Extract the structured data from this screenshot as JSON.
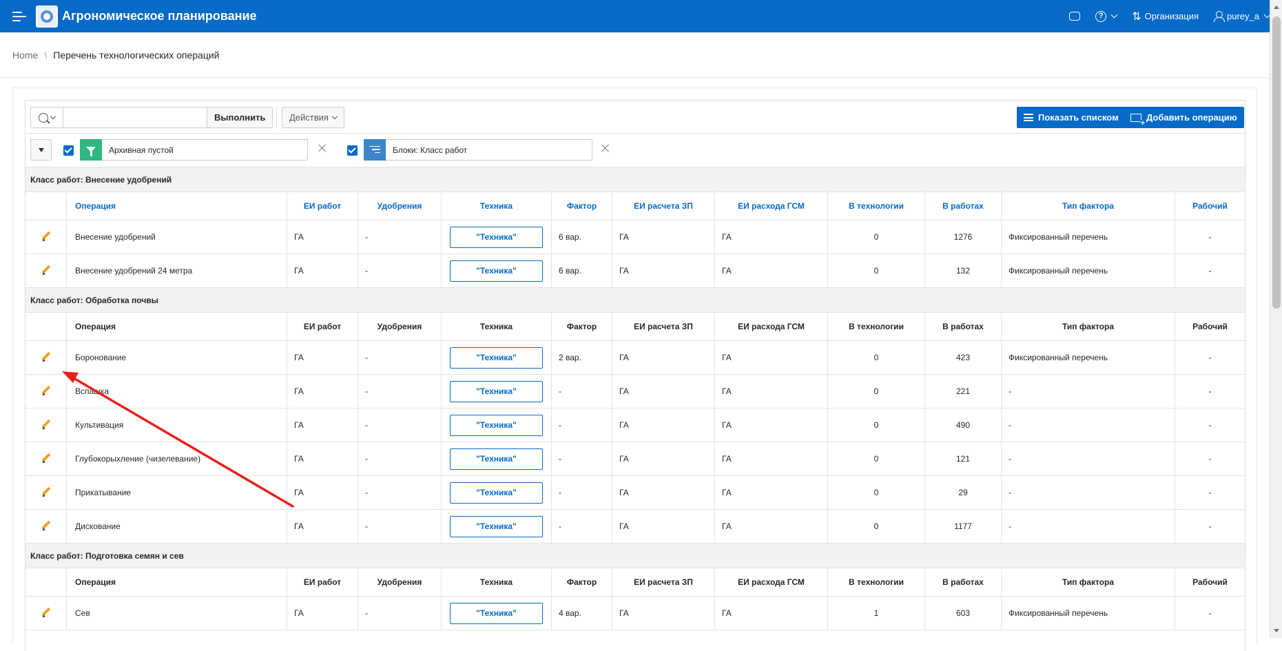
{
  "header": {
    "app_title": "Агрономическое планирование",
    "org_label": "Организация",
    "user_label": "purey_a"
  },
  "breadcrumb": {
    "home": "Home",
    "current": "Перечень технологических операций"
  },
  "toolbar": {
    "search_value": "",
    "exec_label": "Выполнить",
    "actions_label": "Действия",
    "show_list_label": "Показать списком",
    "add_operation_label": "Добавить операцию"
  },
  "filters": [
    {
      "label": "Архивная пустой",
      "type": "filter",
      "color": "#2eb87f"
    },
    {
      "label": "Блоки: Класс работ",
      "type": "control-break",
      "color": "#3a86c8"
    }
  ],
  "columns": [
    "Операция",
    "ЕИ работ",
    "Удобрения",
    "Техника",
    "Фактор",
    "ЕИ расчета ЗП",
    "ЕИ расхода ГСМ",
    "В технологии",
    "В работах",
    "Тип фактора",
    "Рабочий"
  ],
  "tech_button_label": "\"Техника\"",
  "groups": [
    {
      "title": "Класс работ: Внесение удобрений",
      "rows": [
        {
          "operation": "Внесение удобрений",
          "ei_work": "ГА",
          "fert": "-",
          "factor": "6 вар.",
          "ei_zp": "ГА",
          "ei_gsm": "ГА",
          "in_tech": "0",
          "in_works": "1276",
          "factor_type": "Фиксированный перечень",
          "worker": "-"
        },
        {
          "operation": "Внесение удобрений 24 метра",
          "ei_work": "ГА",
          "fert": "-",
          "factor": "6 вар.",
          "ei_zp": "ГА",
          "ei_gsm": "ГА",
          "in_tech": "0",
          "in_works": "132",
          "factor_type": "Фиксированный перечень",
          "worker": "-"
        }
      ]
    },
    {
      "title": "Класс работ: Обработка почвы",
      "rows": [
        {
          "operation": "Боронование",
          "ei_work": "ГА",
          "fert": "-",
          "factor": "2 вар.",
          "ei_zp": "ГА",
          "ei_gsm": "ГА",
          "in_tech": "0",
          "in_works": "423",
          "factor_type": "Фиксированный перечень",
          "worker": "-"
        },
        {
          "operation": "Вспашка",
          "ei_work": "ГА",
          "fert": "-",
          "factor": "-",
          "ei_zp": "ГА",
          "ei_gsm": "ГА",
          "in_tech": "0",
          "in_works": "221",
          "factor_type": "-",
          "worker": "-"
        },
        {
          "operation": "Культивация",
          "ei_work": "ГА",
          "fert": "-",
          "factor": "-",
          "ei_zp": "ГА",
          "ei_gsm": "ГА",
          "in_tech": "0",
          "in_works": "490",
          "factor_type": "-",
          "worker": "-"
        },
        {
          "operation": "Глубокорыхление (чизелевание)",
          "ei_work": "ГА",
          "fert": "-",
          "factor": "-",
          "ei_zp": "ГА",
          "ei_gsm": "ГА",
          "in_tech": "0",
          "in_works": "121",
          "factor_type": "-",
          "worker": "-"
        },
        {
          "operation": "Прикатывание",
          "ei_work": "ГА",
          "fert": "-",
          "factor": "-",
          "ei_zp": "ГА",
          "ei_gsm": "ГА",
          "in_tech": "0",
          "in_works": "29",
          "factor_type": "-",
          "worker": "-"
        },
        {
          "operation": "Дискование",
          "ei_work": "ГА",
          "fert": "-",
          "factor": "-",
          "ei_zp": "ГА",
          "ei_gsm": "ГА",
          "in_tech": "0",
          "in_works": "1177",
          "factor_type": "-",
          "worker": "-"
        }
      ]
    },
    {
      "title": "Класс работ: Подготовка семян и сев",
      "rows": [
        {
          "operation": "Сев",
          "ei_work": "ГА",
          "fert": "-",
          "factor": "4 вар.",
          "ei_zp": "ГА",
          "ei_gsm": "ГА",
          "in_tech": "1",
          "in_works": "603",
          "factor_type": "Фиксированный перечень",
          "worker": "-"
        }
      ]
    }
  ],
  "colors": {
    "header_bg": "#056ac8",
    "link_blue": "#056ac8",
    "edit_icon": "#f0a020",
    "annotation_arrow": "#e8201c"
  }
}
